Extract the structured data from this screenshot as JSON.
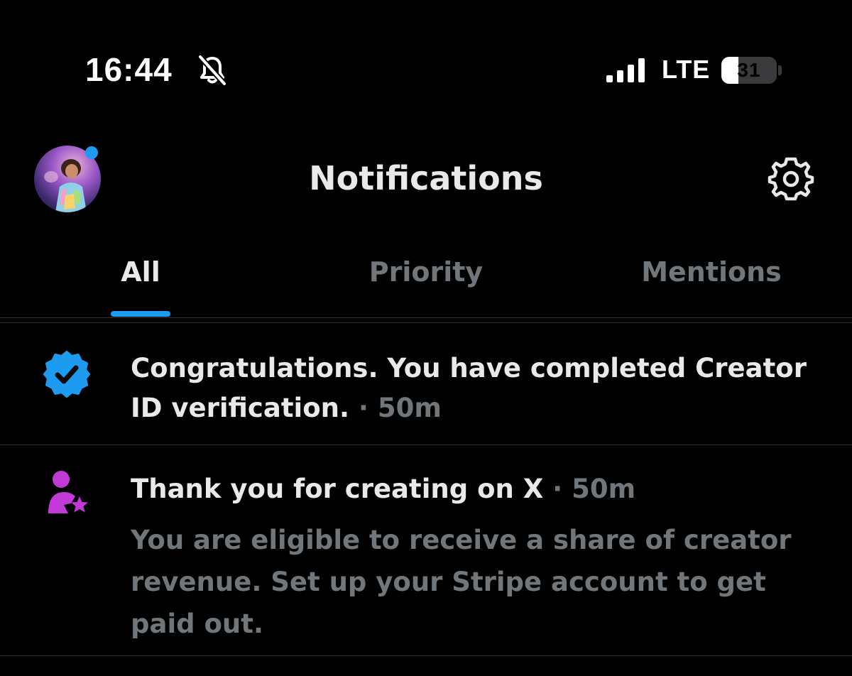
{
  "status_bar": {
    "time": "16:44",
    "network": "LTE",
    "battery_level": "31",
    "battery_fraction": 0.31,
    "silent_icon": "bell-slash-icon",
    "signal_icon": "cellular-signal-icon"
  },
  "header": {
    "title": "Notifications",
    "avatar_icon": "profile-avatar",
    "settings_icon": "gear-icon",
    "unread_dot_color": "#1d9bf0"
  },
  "tabs": [
    {
      "label": "All",
      "active": true
    },
    {
      "label": "Priority",
      "active": false
    },
    {
      "label": "Mentions",
      "active": false
    }
  ],
  "notifications": [
    {
      "icon": "verified-badge-icon",
      "icon_color": "#1d9bf0",
      "text": "Congratulations.  You have completed Creator ID verification.",
      "time": "50m",
      "body": ""
    },
    {
      "icon": "creator-person-star-icon",
      "icon_color": "#c13ad6",
      "text": "Thank you for creating on X",
      "time": "50m",
      "body": "You are eligible to receive a share of creator revenue. Set up your Stripe account to get paid out."
    }
  ],
  "colors": {
    "background": "#000000",
    "primary_text": "#e7e9ea",
    "secondary_text": "#71767b",
    "accent": "#1d9bf0",
    "divider": "#2f3336"
  }
}
